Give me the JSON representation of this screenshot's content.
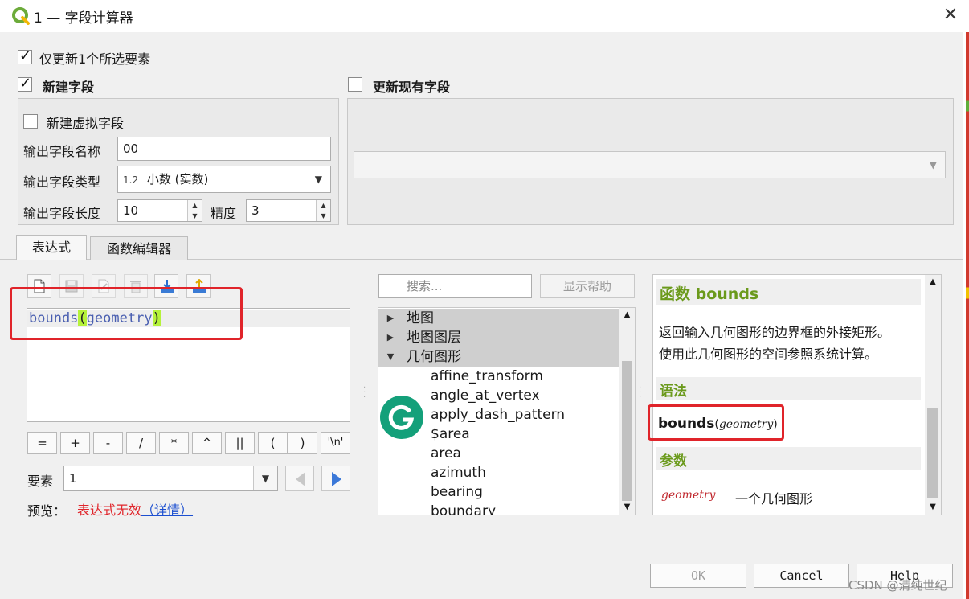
{
  "window": {
    "title": "1 — 字段计算器",
    "close_glyph": "✕"
  },
  "options": {
    "update_selected": "仅更新1个所选要素",
    "new_field": "新建字段",
    "update_existing": "更新现有字段",
    "virtual_field": "新建虚拟字段"
  },
  "output": {
    "name_label": "输出字段名称",
    "name_value": "00",
    "type_label": "输出字段类型",
    "type_prefix": "1.2",
    "type_value": "小数 (实数)",
    "length_label": "输出字段长度",
    "length_value": "10",
    "precision_label": "精度",
    "precision_value": "3"
  },
  "tabs": {
    "expression": "表达式",
    "function_editor": "函数编辑器"
  },
  "expression": {
    "func": "bounds",
    "lparen": "(",
    "arg": "geometry",
    "rparen": ")"
  },
  "operators": [
    "=",
    "+",
    "-",
    "/",
    "*",
    "^",
    "||",
    "(",
    ")",
    "'\\n'"
  ],
  "feature": {
    "label": "要素",
    "value": "1"
  },
  "preview": {
    "label": "预览：",
    "status": "表达式无效",
    "details": "（详情）"
  },
  "search": {
    "placeholder": "搜索..."
  },
  "show_help": "显示帮助",
  "tree": {
    "groups": [
      "地图",
      "地图图层",
      "几何图形"
    ],
    "items": [
      "affine_transform",
      "angle_at_vertex",
      "apply_dash_pattern",
      "$area",
      "area",
      "azimuth",
      "bearing",
      "boundary"
    ]
  },
  "help": {
    "title": "函数 bounds",
    "description_1": "返回输入几何图形的边界框的外接矩形。",
    "description_2": "使用此几何图形的空间参照系统计算。",
    "syntax_header": "语法",
    "syntax_func": "bounds",
    "syntax_lparen": "(",
    "syntax_arg": "geometry",
    "syntax_rparen": ")",
    "params_header": "参数",
    "param_name": "geometry",
    "param_desc": "一个几何图形"
  },
  "buttons": {
    "ok": "OK",
    "cancel": "Cancel",
    "help": "Help"
  },
  "watermark": "CSDN @清纯世纪",
  "colors": {
    "accent_green": "#6b9a1c",
    "highlight": "#b5f23a",
    "error_red": "#e0242a",
    "link_blue": "#1c4fd0"
  }
}
